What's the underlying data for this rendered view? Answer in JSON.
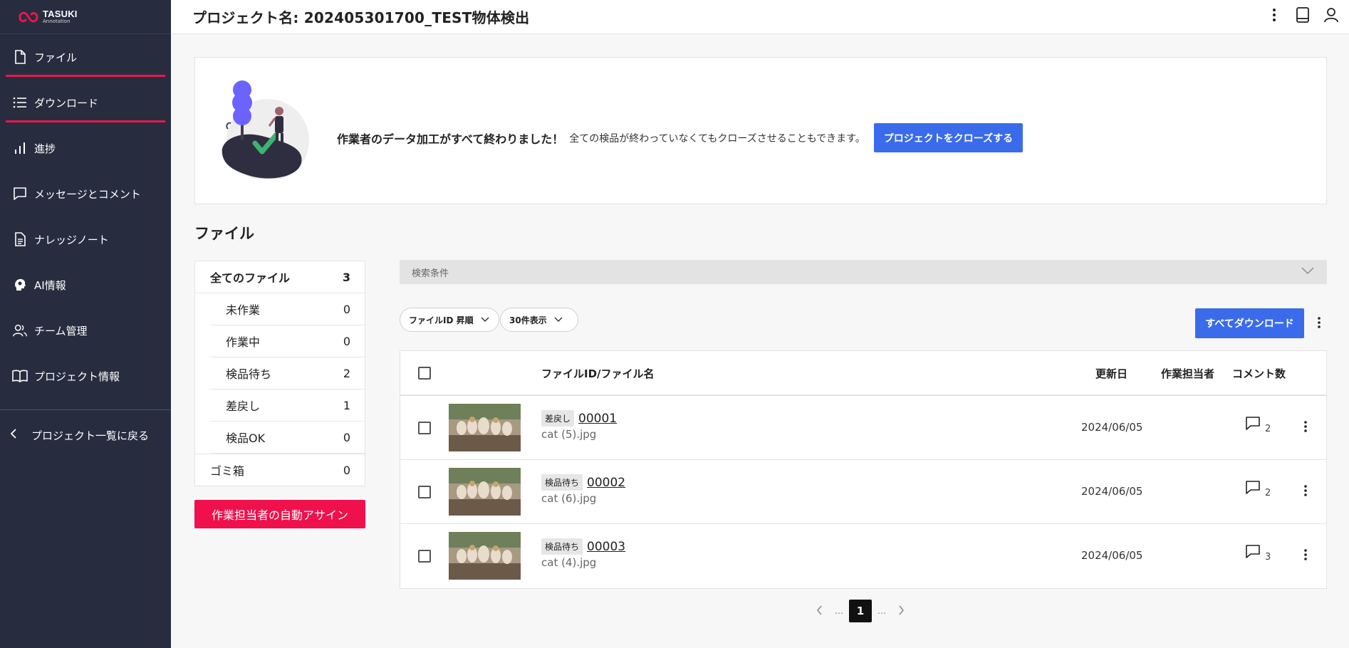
{
  "brand": {
    "name": "TASUKI",
    "sub": "Annotation",
    "accent": "#e8174c"
  },
  "header": {
    "title": "プロジェクト名: 202405301700_TEST物体検出"
  },
  "sidebar": {
    "items": [
      {
        "label": "ファイル",
        "icon": "file-icon",
        "active": true
      },
      {
        "label": "ダウンロード",
        "icon": "list-icon",
        "active": true
      },
      {
        "label": "進捗",
        "icon": "bar-chart-icon"
      },
      {
        "label": "メッセージとコメント",
        "icon": "message-icon"
      },
      {
        "label": "ナレッジノート",
        "icon": "document-icon"
      },
      {
        "label": "AI情報",
        "icon": "ai-head-icon"
      },
      {
        "label": "チーム管理",
        "icon": "team-icon"
      },
      {
        "label": "プロジェクト情報",
        "icon": "book-icon"
      }
    ],
    "back_label": "プロジェクト一覧に戻る"
  },
  "banner": {
    "strong": "作業者のデータ加工がすべて終わりました！",
    "note": "全ての検品が終わっていなくてもクローズさせることもできます。",
    "close_button": "プロジェクトをクローズする"
  },
  "section_title": "ファイル",
  "filters": {
    "all": {
      "label": "全てのファイル",
      "count": "3"
    },
    "statuses": [
      {
        "label": "未作業",
        "count": "0"
      },
      {
        "label": "作業中",
        "count": "0"
      },
      {
        "label": "検品待ち",
        "count": "2"
      },
      {
        "label": "差戻し",
        "count": "1"
      },
      {
        "label": "検品OK",
        "count": "0"
      }
    ],
    "trash": {
      "label": "ゴミ箱",
      "count": "0"
    }
  },
  "auto_assign_button": "作業担当者の自動アサイン",
  "search": {
    "label": "検索条件"
  },
  "sort": {
    "label": "ファイルID 昇順"
  },
  "per_page": {
    "label": "30件表示"
  },
  "download_all_button": "すべてダウンロード",
  "table": {
    "headers": {
      "name": "ファイルID/ファイル名",
      "date": "更新日",
      "worker": "作業担当者",
      "comments": "コメント数"
    },
    "rows": [
      {
        "status": "差戻し",
        "id": "00001",
        "filename": "cat (5).jpg",
        "date": "2024/06/05",
        "comments": "2"
      },
      {
        "status": "検品待ち",
        "id": "00002",
        "filename": "cat (6).jpg",
        "date": "2024/06/05",
        "comments": "2"
      },
      {
        "status": "検品待ち",
        "id": "00003",
        "filename": "cat (4).jpg",
        "date": "2024/06/05",
        "comments": "3"
      }
    ]
  },
  "pagination": {
    "current": "1",
    "dots": "..."
  },
  "colors": {
    "sidebar": "#272d3f",
    "primary": "#3a6bea",
    "danger": "#f0104b"
  }
}
